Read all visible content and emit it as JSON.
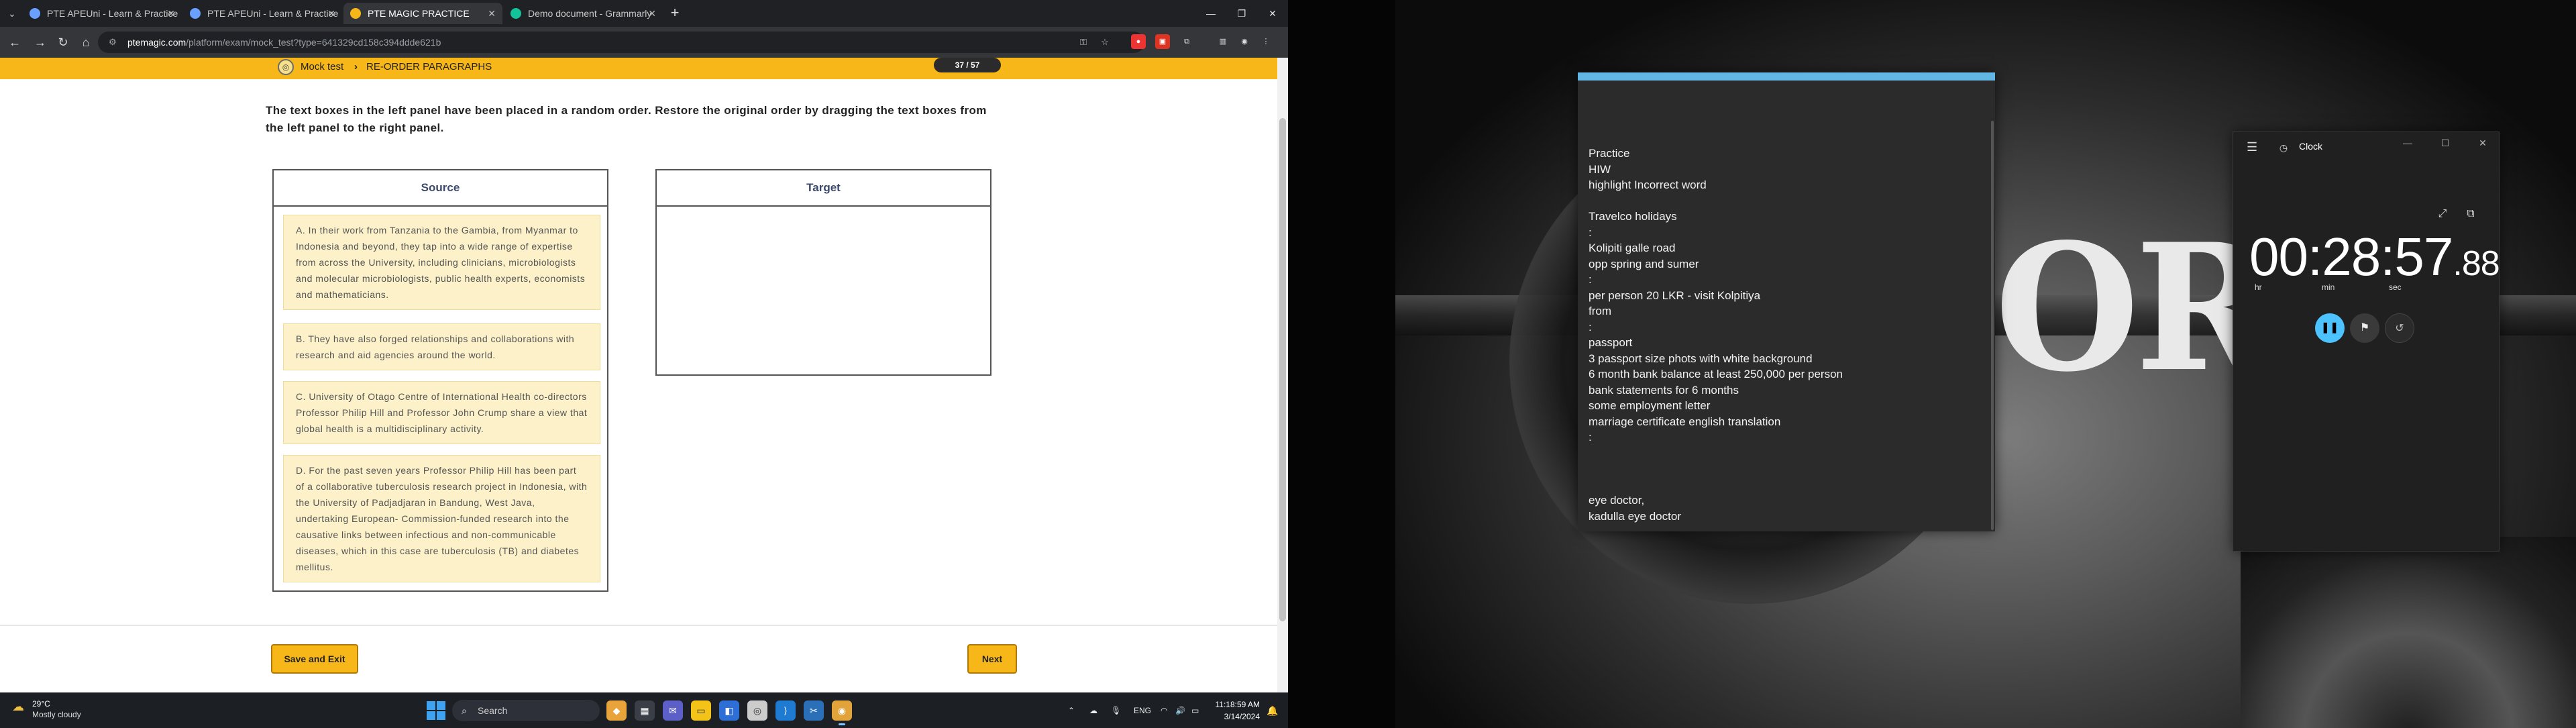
{
  "browser": {
    "tabs": [
      {
        "label": "PTE APEUni - Learn & Practice",
        "fav_color": "#6aa0ff",
        "active": false
      },
      {
        "label": "PTE APEUni - Learn & Practice",
        "fav_color": "#6aa0ff",
        "active": false
      },
      {
        "label": "PTE MAGIC PRACTICE",
        "fav_color": "#f7b718",
        "active": true
      },
      {
        "label": "Demo document - Grammarly",
        "fav_color": "#15c39a",
        "active": false
      }
    ],
    "url_host": "ptemagic.com",
    "url_rest": "/platform/exam/mock_test?type=641329cd158c394ddde621b"
  },
  "exam": {
    "crumb_root": "Mock test",
    "crumb_current": "RE-ORDER PARAGRAPHS",
    "counter": "37 / 57",
    "instructions": "The text boxes in the left panel have been placed in a random order. Restore the original order by dragging the text boxes from the left panel to the right panel.",
    "source_title": "Source",
    "target_title": "Target",
    "items": [
      "A. In their work from Tanzania to the Gambia, from Myanmar to Indonesia and beyond, they tap into a wide range of expertise from across the University, including clinicians, microbiologists and molecular microbiologists, public health experts, economists and mathematicians.",
      "B. They have also forged relationships and collaborations with research and aid agencies around the world.",
      "C. University of Otago Centre of International Health co-directors Professor Philip Hill and Professor John Crump share a view that global health is a multidisciplinary activity.",
      "D. For the past seven years Professor Philip Hill has been part of a collaborative tuberculosis research project in Indonesia, with the University of Padjadjaran in Bandung, West Java, undertaking European- Commission-funded research into the causative links between infectious and non-communicable diseases, which in this case are tuberculosis (TB) and diabetes mellitus."
    ],
    "save_exit_label": "Save and Exit",
    "next_label": "Next"
  },
  "taskbar": {
    "temperature": "29°C",
    "weather": "Mostly cloudy",
    "search_label": "Search",
    "language": "ENG",
    "time": "11:18:59 AM",
    "date": "3/14/2024"
  },
  "wallpaper": {
    "text": "ORI"
  },
  "notes": {
    "lines": [
      "Practice",
      "HIW",
      "highlight Incorrect word",
      "",
      "Travelco holidays",
      ":",
      "Kolipiti galle road",
      "opp spring and sumer",
      ":",
      "per person 20 LKR  - visit Kolpitiya",
      "from",
      ":",
      "passport",
      "3 passport size phots with white background",
      "6 month bank balance  at least 250,000 per person",
      "bank statements  for 6 months",
      "some employment letter",
      "marriage certificate english translation",
      ":",
      "",
      "",
      "",
      "eye doctor,",
      "kadulla eye doctor"
    ]
  },
  "clock": {
    "title": "Clock",
    "time_main": "00:28:57",
    "time_hundredths": ".88",
    "unit_hr": "hr",
    "unit_min": "min",
    "unit_sec": "sec"
  }
}
